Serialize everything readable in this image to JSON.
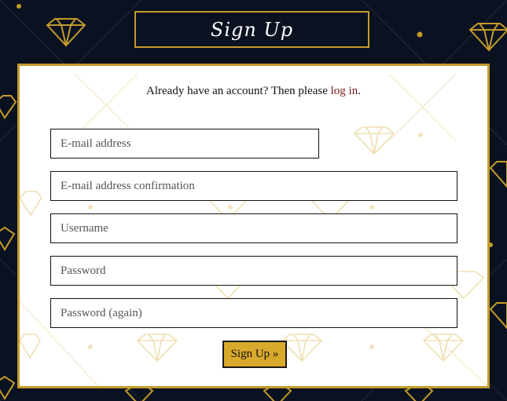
{
  "page": {
    "title": "Sign Up"
  },
  "signup": {
    "prompt_before": "Already have an account? Then please ",
    "login_link": "log in",
    "prompt_after": ".",
    "fields": {
      "email": {
        "placeholder": "E-mail address",
        "value": ""
      },
      "email_confirm": {
        "placeholder": "E-mail address confirmation",
        "value": ""
      },
      "username": {
        "placeholder": "Username",
        "value": ""
      },
      "password": {
        "placeholder": "Password",
        "value": ""
      },
      "password_again": {
        "placeholder": "Password (again)",
        "value": ""
      }
    },
    "submit_label": "Sign Up »"
  },
  "colors": {
    "background": "#0a1120",
    "gold_accent": "#c39b2a",
    "button": "#d9a92b",
    "link": "#7a1a1a"
  }
}
